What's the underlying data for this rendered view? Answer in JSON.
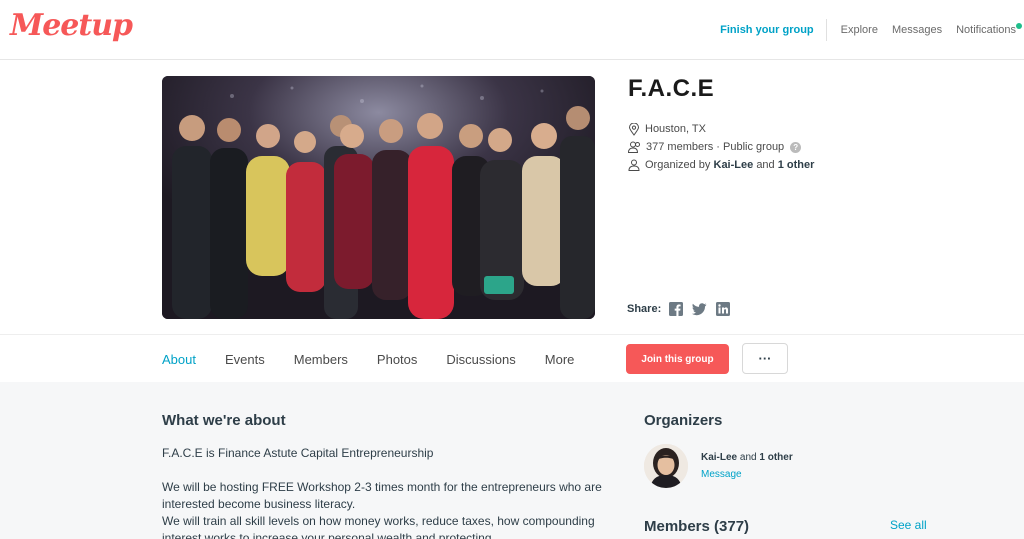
{
  "brand": {
    "logo": "Meetup",
    "accent": "#f65858",
    "link": "#00a2c7"
  },
  "topnav": {
    "finish": "Finish your group",
    "explore": "Explore",
    "messages": "Messages",
    "notifications": "Notifications"
  },
  "group": {
    "name": "F.A.C.E",
    "location": "Houston, TX",
    "members_text": "377 members · Public group",
    "organized_prefix": "Organized by",
    "organizer_name": "Kai-Lee",
    "organized_and": "and",
    "organizer_other": "1 other",
    "help": "?"
  },
  "share": {
    "label": "Share:"
  },
  "tabs": [
    "About",
    "Events",
    "Members",
    "Photos",
    "Discussions",
    "More"
  ],
  "actions": {
    "join": "Join this group",
    "more": "···"
  },
  "about": {
    "heading": "What we're about",
    "p1": "F.A.C.E is Finance Astute Capital Entrepreneurship",
    "p2": "We will be hosting FREE Workshop 2-3 times month for the entrepreneurs who are interested become business literacy.",
    "p3": "We will train all skill levels on how money works, reduce taxes, how compounding interest works to increase your personal wealth and protecting"
  },
  "organizers": {
    "heading": "Organizers",
    "name": "Kai-Lee",
    "and": "and",
    "other": "1 other",
    "message": "Message"
  },
  "members": {
    "heading": "Members (377)",
    "see_all": "See all"
  }
}
